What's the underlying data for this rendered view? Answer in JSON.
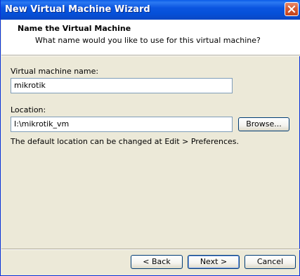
{
  "window": {
    "title": "New Virtual Machine Wizard",
    "close_icon": "close-icon"
  },
  "header": {
    "title": "Name the Virtual Machine",
    "subtitle": "What name would you like to use for this virtual machine?"
  },
  "form": {
    "vm_name_label": "Virtual machine name:",
    "vm_name_value": "mikrotik",
    "location_label": "Location:",
    "location_value": "I:\\mikrotik_vm",
    "browse_label": "Browse...",
    "hint": "The default location can be changed at Edit > Preferences."
  },
  "footer": {
    "back_label": "< Back",
    "next_label": "Next >",
    "cancel_label": "Cancel"
  },
  "colors": {
    "titlebar": "#0a55e0",
    "dialog_bg": "#ece9d8",
    "close_button": "#d55b35"
  }
}
